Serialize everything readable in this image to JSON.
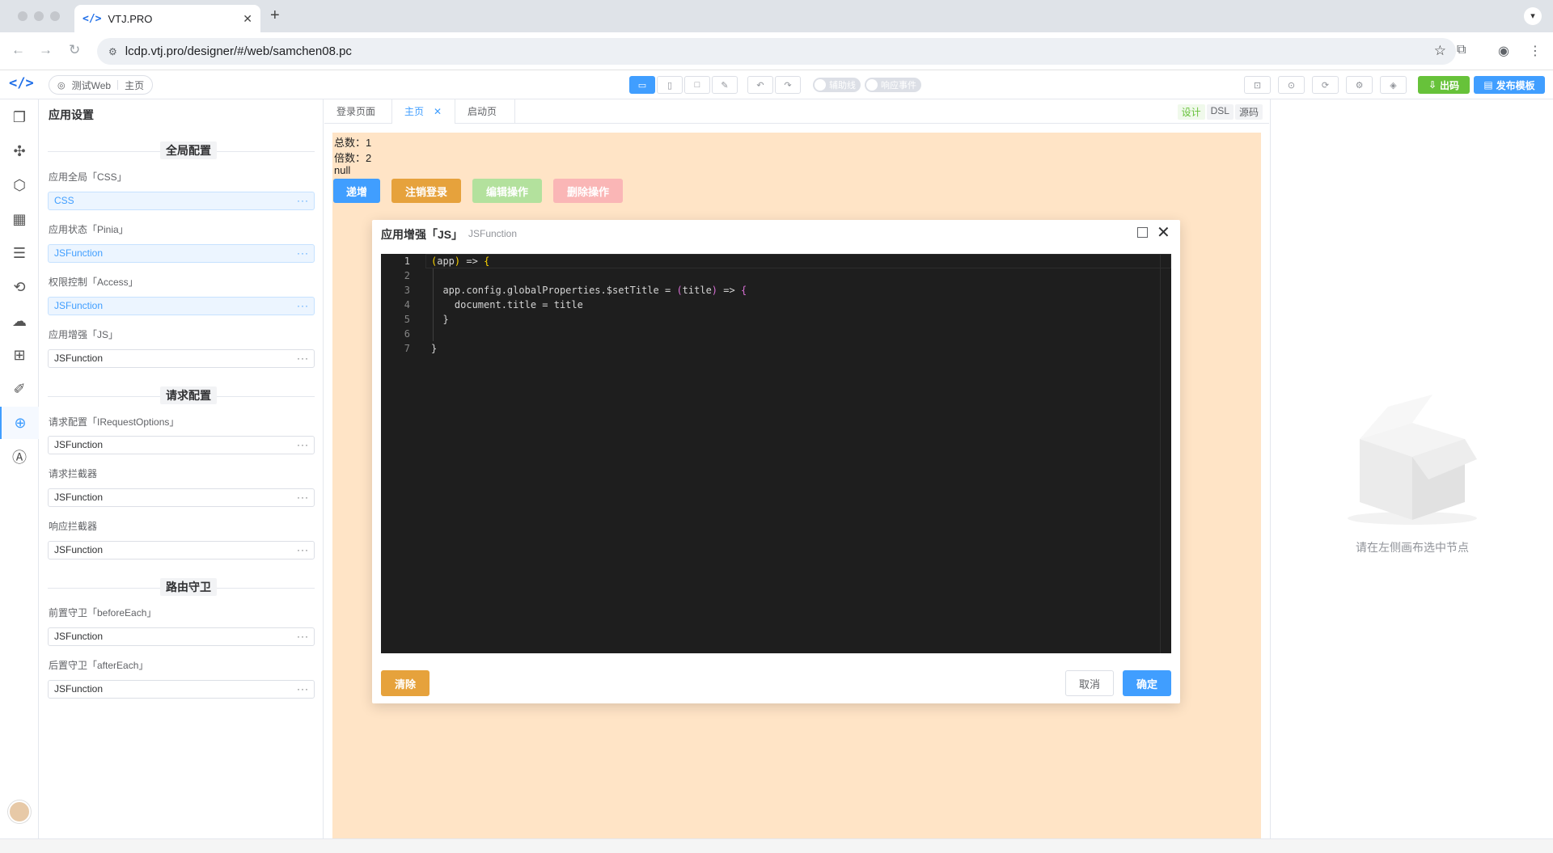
{
  "browser": {
    "tab_title": "VTJ.PRO",
    "tab_close": "✕",
    "new_tab": "+",
    "url": "lcdp.vtj.pro/designer/#/web/samchen08.pc"
  },
  "toolbar": {
    "breadcrumb_project": "测试Web",
    "breadcrumb_page": "主页",
    "switch_guides": "辅助线",
    "switch_events": "响应事件",
    "btn_export": "出码",
    "btn_publish": "发布模板"
  },
  "settings": {
    "title": "应用设置",
    "sections": {
      "global": "全局配置",
      "request": "请求配置",
      "router": "路由守卫"
    },
    "fields": [
      {
        "label": "应用全局「CSS」",
        "value": "CSS"
      },
      {
        "label": "应用状态「Pinia」",
        "value": "JSFunction"
      },
      {
        "label": "权限控制「Access」",
        "value": "JSFunction"
      },
      {
        "label": "应用增强「JS」",
        "value": "JSFunction"
      },
      {
        "label": "请求配置「IRequestOptions」",
        "value": "JSFunction"
      },
      {
        "label": "请求拦截器",
        "value": "JSFunction"
      },
      {
        "label": "响应拦截器",
        "value": "JSFunction"
      },
      {
        "label": "前置守卫「beforeEach」",
        "value": "JSFunction"
      },
      {
        "label": "后置守卫「afterEach」",
        "value": "JSFunction"
      }
    ],
    "more": "···"
  },
  "designer": {
    "tabs": [
      "登录页面",
      "主页",
      "启动页"
    ],
    "tab_close": "✕",
    "modes": [
      "设计",
      "DSL",
      "源码"
    ],
    "lines": [
      "总数：1",
      "倍数：2",
      "null"
    ],
    "buttons": [
      "递增",
      "注销登录",
      "编辑操作",
      "删除操作"
    ]
  },
  "dialog": {
    "title": "应用增强「JS」",
    "subtitle": "JSFunction",
    "close": "✕",
    "line_numbers": [
      "1",
      "2",
      "3",
      "4",
      "5",
      "6",
      "7"
    ],
    "code": {
      "l1_a": "(",
      "l1_b": "app",
      "l1_c": ")",
      "l1_d": " => ",
      "l1_e": "{",
      "l3_a": "  app.config.globalProperties.$setTitle = ",
      "l3_b": "(",
      "l3_c": "title",
      "l3_d": ")",
      "l3_e": " => ",
      "l3_f": "{",
      "l4": "    document.title = title",
      "l5": "  }",
      "l7": "}"
    },
    "btn_clear": "清除",
    "btn_cancel": "取消",
    "btn_ok": "确定"
  },
  "right_panel": {
    "empty_text": "请在左侧画布选中节点"
  },
  "colors": {
    "primary": "#409eff",
    "success": "#67c23a",
    "warning": "#e6a23c",
    "danger": "#f56c6c",
    "canvas_bg": "#ffe4c6"
  }
}
